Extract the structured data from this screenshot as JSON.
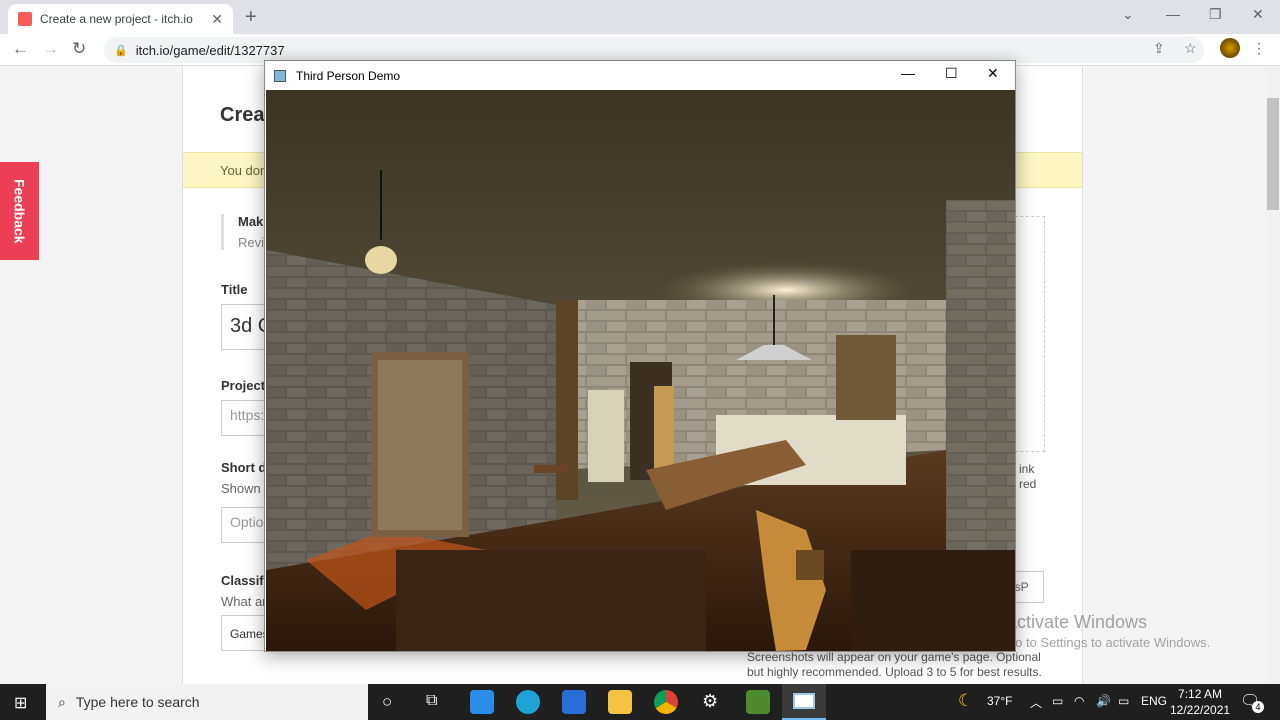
{
  "browser": {
    "tab_title": "Create a new project - itch.io",
    "url": "itch.io/game/edit/1327737"
  },
  "page": {
    "title_partial": "Creat",
    "banner_partial": "You don",
    "note_bold": "Mak",
    "note_sub": "Revi",
    "title_label": "Title",
    "title_value": "3d C",
    "project_label": "Project",
    "project_placeholder": "https:",
    "short_label": "Short de",
    "short_sub": "Shown v",
    "short_placeholder": "Optio",
    "class_label": "Classific",
    "class_sub": "What ar",
    "class_value": "Games",
    "right_link1": "ink",
    "right_link2": "red",
    "code_partial": "7sP",
    "screenshots_note": "Screenshots will appear on your game's page. Optional but highly recommended. Upload 3 to 5 for best results.",
    "feedback": "Feedback"
  },
  "game_window": {
    "title": "Third Person Demo"
  },
  "watermark": {
    "line1": "Activate Windows",
    "line2": "Go to Settings to activate Windows."
  },
  "taskbar": {
    "search_placeholder": "Type here to search",
    "temp": "37°F",
    "lang": "ENG",
    "time": "7:12 AM",
    "date": "12/22/2021",
    "notif_count": "4"
  },
  "colors": {
    "feedback": "#ec3f56",
    "banner": "#fcf7c3"
  }
}
